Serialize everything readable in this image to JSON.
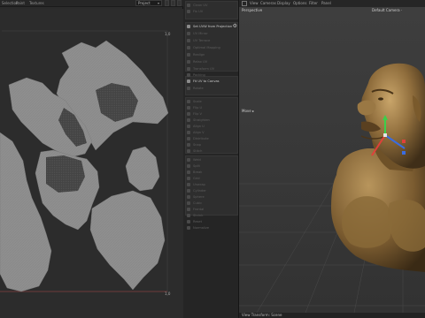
{
  "uv_editor": {
    "menu": [
      "Selection",
      "Paint",
      "Textures"
    ],
    "project_select": "Project",
    "corner_top_right": "1,0",
    "corner_bottom_right": "1,0"
  },
  "tools": {
    "items": [
      {
        "label": "Clean UV",
        "active": false
      },
      {
        "label": "Fix UV",
        "active": false
      },
      {
        "label": "Set UVW from Projection",
        "active": true
      },
      {
        "label": "UV Mirror",
        "active": false
      },
      {
        "label": "UV Terrace",
        "active": false
      },
      {
        "label": "Optimal Mapping",
        "active": false
      },
      {
        "label": "Realign",
        "active": false
      },
      {
        "label": "Relax UV",
        "active": false
      },
      {
        "label": "Transform UV",
        "active": false
      },
      {
        "label": "Packing",
        "active": false
      },
      {
        "label": "Fit UV to Canvas",
        "active": true
      },
      {
        "label": "Rotate",
        "active": false
      },
      {
        "label": "Scale",
        "active": false
      },
      {
        "label": "Flip U",
        "active": false
      },
      {
        "label": "Flip V",
        "active": false
      },
      {
        "label": "Straighten",
        "active": false
      },
      {
        "label": "Align U",
        "active": false
      },
      {
        "label": "Align V",
        "active": false
      },
      {
        "label": "Distribute",
        "active": false
      },
      {
        "label": "Snap",
        "active": false
      },
      {
        "label": "Stitch",
        "active": false
      },
      {
        "label": "Weld",
        "active": false
      },
      {
        "label": "Split",
        "active": false
      },
      {
        "label": "Break",
        "active": false
      },
      {
        "label": "Grid",
        "active": false
      },
      {
        "label": "Unwrap",
        "active": false
      },
      {
        "label": "Cylinder",
        "active": false
      },
      {
        "label": "Sphere",
        "active": false
      },
      {
        "label": "Cubic",
        "active": false
      },
      {
        "label": "Frontal",
        "active": false
      },
      {
        "label": "Shrink",
        "active": false
      },
      {
        "label": "Reset",
        "active": false
      },
      {
        "label": "Normalize",
        "active": false
      }
    ]
  },
  "viewport": {
    "menu": [
      "View",
      "Cameras",
      "Display",
      "Options",
      "Filter",
      "Panel"
    ],
    "view_name": "Perspective",
    "camera": "Default Camera ·",
    "move_label": "Move ▸",
    "status": "View Transform: Scene",
    "accent_colors": {
      "x_axis": "#e0403a",
      "y_axis": "#3ccf4a",
      "z_axis": "#3a6ce0",
      "bust": "#8a6a3a"
    }
  }
}
